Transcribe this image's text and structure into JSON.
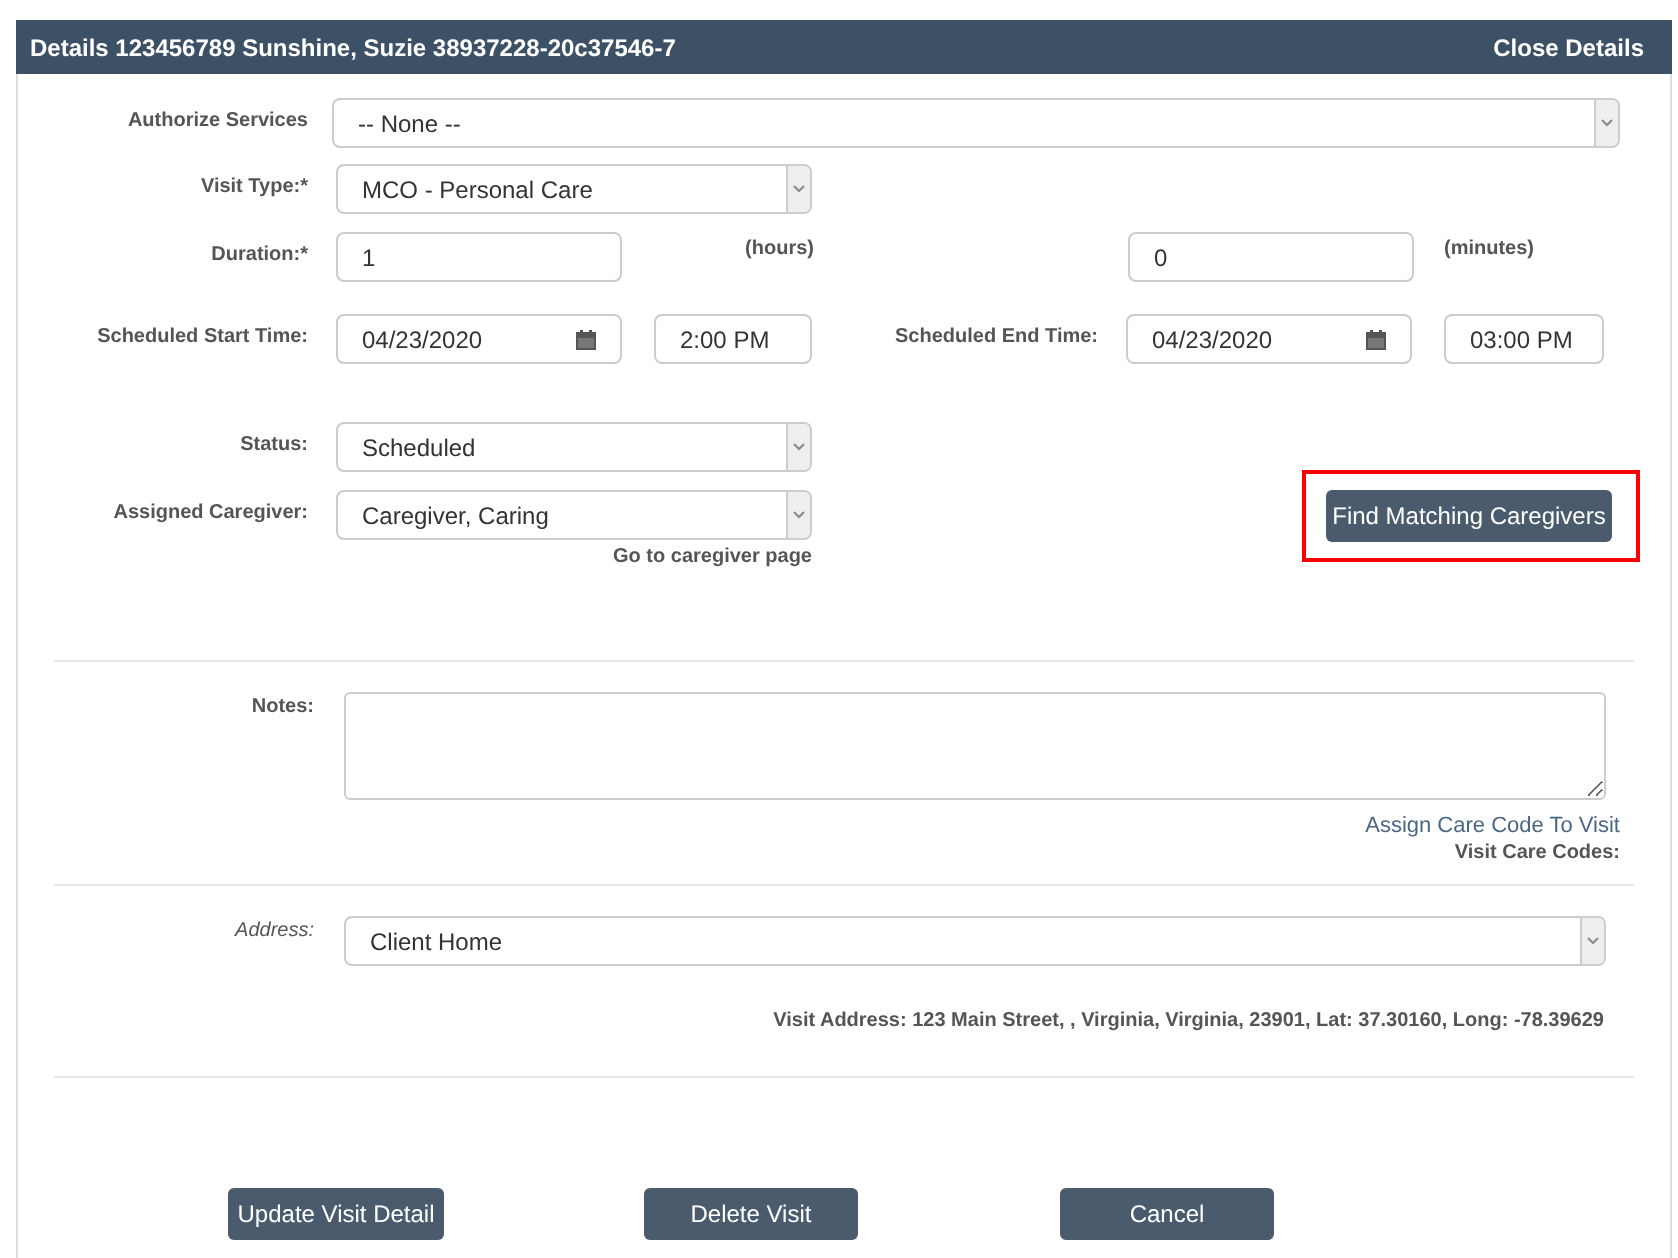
{
  "header": {
    "title": "Details 123456789 Sunshine, Suzie 38937228-20c37546-7",
    "close_label": "Close Details"
  },
  "authorize_services": {
    "label": "Authorize Services",
    "value": "-- None --"
  },
  "visit_type": {
    "label": "Visit Type:*",
    "value": "MCO - Personal Care"
  },
  "duration": {
    "label": "Duration:*",
    "hours": "1",
    "hours_unit": "(hours)",
    "minutes": "0",
    "minutes_unit": "(minutes)"
  },
  "start": {
    "label": "Scheduled Start Time:",
    "date": "04/23/2020",
    "time": "2:00 PM"
  },
  "end": {
    "label": "Scheduled End Time:",
    "date": "04/23/2020",
    "time": "03:00 PM"
  },
  "status": {
    "label": "Status:",
    "value": "Scheduled"
  },
  "caregiver": {
    "label": "Assigned Caregiver:",
    "value": "Caregiver, Caring",
    "link": "Go to caregiver page"
  },
  "find_button": {
    "label": "Find Matching Caregivers",
    "highlighted": true
  },
  "notes": {
    "label": "Notes:"
  },
  "care_codes": {
    "link": "Assign Care Code To Visit",
    "label": "Visit Care Codes:"
  },
  "address": {
    "label": "Address:",
    "value": "Client Home",
    "visit_address": "Visit Address: 123 Main Street, , Virginia, Virginia, 23901, Lat: 37.30160, Long: -78.39629"
  },
  "buttons": [
    "Update Visit Detail",
    "Delete Visit",
    "Cancel"
  ]
}
